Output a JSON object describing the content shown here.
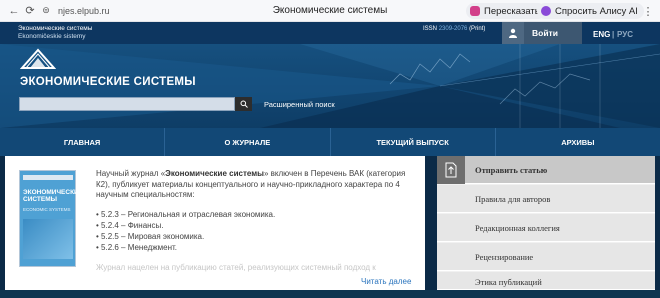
{
  "browser": {
    "url": "njes.elpub.ru",
    "tab_title": "Экономические системы",
    "retell_label": "Пересказать",
    "alice_label": "Спросить Алису AI"
  },
  "site": {
    "journal_ru": "Экономические системы",
    "journal_en": "Ekonomičeskie sistemy",
    "issn_label": "ISSN",
    "issn_number": "2309-2076",
    "issn_type": "(Print)",
    "login_label": "Войти",
    "lang_eng": "ENG",
    "lang_sep": "|",
    "lang_rus": "РУС",
    "title": "ЭКОНОМИЧЕСКИЕ СИСТЕМЫ",
    "advanced_search": "Расширенный поиск",
    "search_placeholder": ""
  },
  "menu": [
    "ГЛАВНАЯ",
    "О ЖУРНАЛЕ",
    "ТЕКУЩИЙ ВЫПУСК",
    "АРХИВЫ"
  ],
  "main": {
    "intro_prefix": "Научный журнал «",
    "intro_bold": "Экономические системы",
    "intro_rest": "» включен в Перечень ВАК (категория К2), публикует материалы концептуального и научно-прикладного характера по 4 научным специальностям:",
    "specialties": [
      "5.2.3 – Региональная и отраслевая экономика.",
      "5.2.4 – Финансы.",
      "5.2.5 – Мировая экономика.",
      "5.2.6 – Менеджмент."
    ],
    "faded_text": "Журнал нацелен на публикацию статей, реализующих системный подход к",
    "read_more": "Читать далее",
    "cover": {
      "title_line1": "ЭКОНОМИЧЕСКИЕ",
      "title_line2": "СИСТЕМЫ",
      "subtitle": "ECONOMIC SYSTEMS"
    }
  },
  "sidebar": [
    "Отправить статью",
    "Правила для авторов",
    "Редакционная коллегия",
    "Рецензирование",
    "Этика публикаций"
  ],
  "colors": {
    "header_bg": "#0d3660",
    "hero_bg": "#16507f",
    "menu_bg": "#124876",
    "link": "#2a74bd"
  }
}
